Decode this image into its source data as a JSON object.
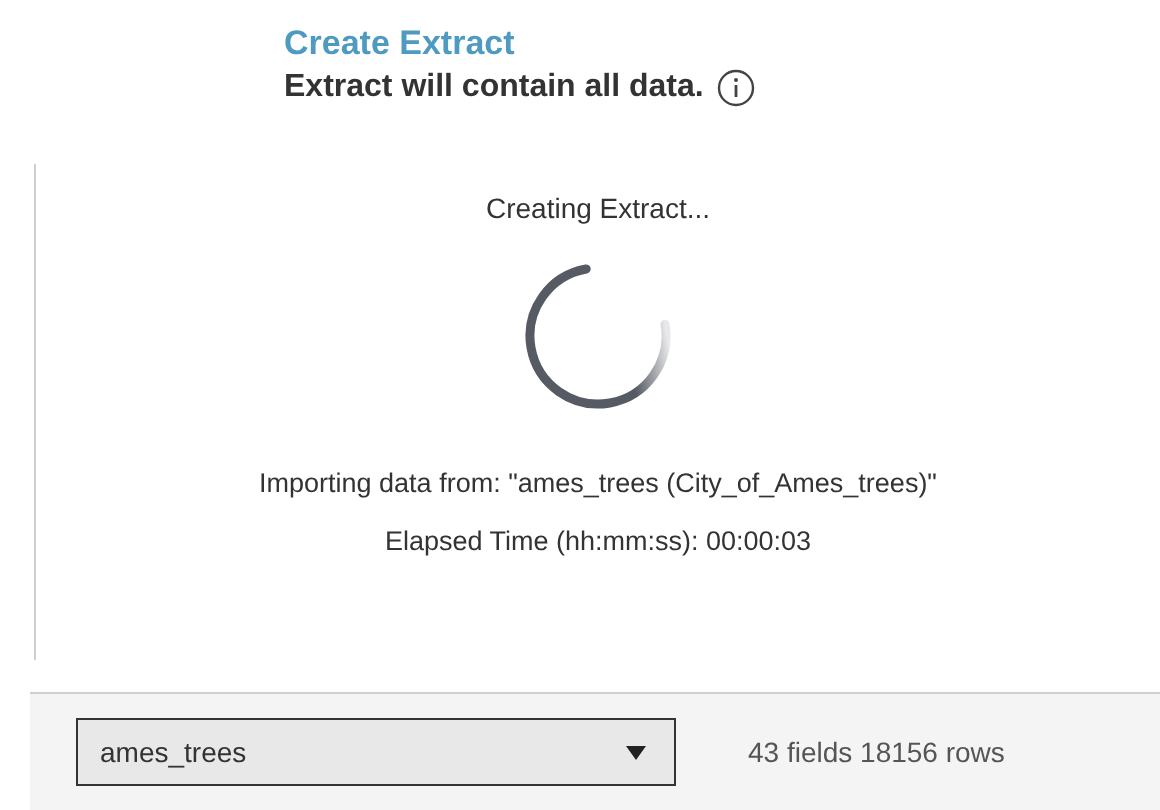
{
  "header": {
    "title": "Create Extract",
    "subtitle": "Extract will contain all data."
  },
  "progress": {
    "status": "Creating Extract...",
    "source": "Importing data from: \"ames_trees (City_of_Ames_trees)\"",
    "elapsed": "Elapsed Time (hh:mm:ss): 00:00:03"
  },
  "footer": {
    "table_select": "ames_trees",
    "stats": "43 fields 18156 rows"
  }
}
